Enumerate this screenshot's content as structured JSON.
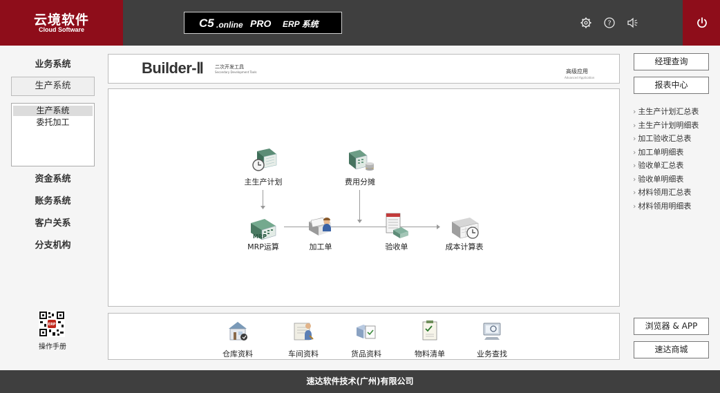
{
  "header": {
    "logo_cn": "云境软件",
    "logo_en": "Cloud Software",
    "product": {
      "c5": "C5",
      "online": ".online",
      "pro": "PRO",
      "erp": "ERP 系统"
    },
    "icons": [
      "gear-icon",
      "help-icon",
      "speaker-icon",
      "power-icon"
    ]
  },
  "left_nav": {
    "items_top": [
      "业务系统",
      "生产系统"
    ],
    "sub_items": [
      "生产系统",
      "委托加工"
    ],
    "items_bottom": [
      "资金系统",
      "账务系统",
      "客户关系",
      "分支机构"
    ],
    "manual": "操作手册"
  },
  "banner": {
    "title": "Builder-Ⅱ",
    "sub_cn": "二次开发工具",
    "sub_en": "Secondary Development Tools",
    "adv_cn": "高级应用",
    "adv_en": "Advanced Application"
  },
  "flow": {
    "master_plan": "主生产计划",
    "cost_alloc": "费用分摊",
    "mrp": "MRP运算",
    "processing": "加工单",
    "acceptance": "验收单",
    "costing": "成本计算表"
  },
  "tools": [
    "仓库资料",
    "车间资料",
    "货品资料",
    "物料清单",
    "业务查找"
  ],
  "right": {
    "btn_manager": "经理查询",
    "btn_report": "报表中心",
    "links": [
      "主生产计划汇总表",
      "主生产计划明细表",
      "加工验收汇总表",
      "加工单明细表",
      "验收单汇总表",
      "验收单明细表",
      "材料领用汇总表",
      "材料领用明细表"
    ],
    "btn_browser": "浏览器 & APP",
    "btn_mall": "速达商城"
  },
  "footer": "速达软件技术(广州)有限公司",
  "colors": {
    "brand_red": "#8e0d1a",
    "header_gray": "#3f3f3f"
  }
}
